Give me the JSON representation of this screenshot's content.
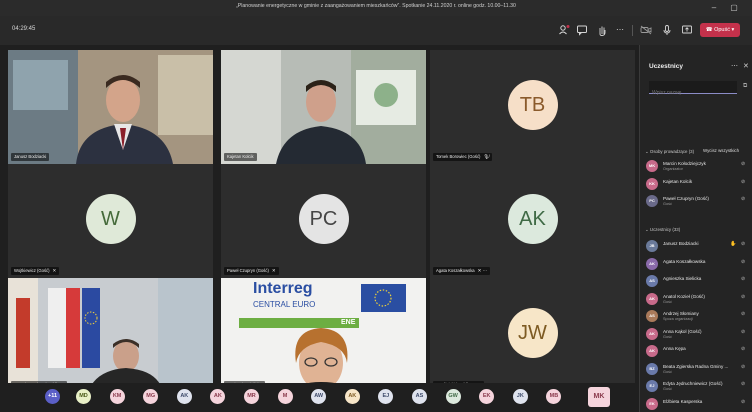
{
  "window": {
    "title": "„Planowanie energetyczne w gminie z zaangażowaniem mieszkańców”. Spotkanie 24.11.2020 r. online godz. 10.00–11.30"
  },
  "toolbar": {
    "timer": "04:29:45",
    "leave_label": "Opuść"
  },
  "tiles": [
    {
      "label": "Janusz Bodziacki",
      "type": "video",
      "bg": "#7a6a5a"
    },
    {
      "label": "Kajetan Kolcik",
      "type": "video",
      "bg": "#8a8f86"
    },
    {
      "label": "Tomek Borowiec (Gość)",
      "type": "avatar",
      "initials": "TB",
      "avatar_bg": "#f6dfc8",
      "avatar_fg": "#8a5a2b"
    },
    {
      "label": "Wojtkiewicz (Gość)",
      "type": "avatar",
      "initials": "W",
      "avatar_bg": "#dfe9d8",
      "avatar_fg": "#456a3a"
    },
    {
      "label": "Paweł Czupryn (Gość)",
      "type": "avatar",
      "initials": "PC",
      "avatar_bg": "#e4e4e4",
      "avatar_fg": "#454545"
    },
    {
      "label": "Agata Koszałkowska",
      "type": "avatar",
      "initials": "AK",
      "avatar_bg": "#dce9dd",
      "avatar_fg": "#3f6a45"
    },
    {
      "label": "Henryk Smolarz (Gość)",
      "type": "video",
      "bg": "#8d9aa6"
    },
    {
      "label": "Agnieszka Sielicka",
      "type": "video",
      "bg": "#e9ecec"
    },
    {
      "label": "J Wójcicki (Gość)",
      "type": "avatar",
      "initials": "JW",
      "avatar_bg": "#f7e6c8",
      "avatar_fg": "#7d5a22"
    }
  ],
  "slide": {
    "brand": "Interreg",
    "program": "CENTRAL EURO",
    "partial": "ENE"
  },
  "overflow": {
    "count": "+11",
    "avatars": [
      {
        "initials": "MD",
        "bg": "#e8f0c7",
        "fg": "#4a5a18"
      },
      {
        "initials": "KM",
        "bg": "#f5d4dc",
        "fg": "#8a3a4c"
      },
      {
        "initials": "MG",
        "bg": "#f5d4dc",
        "fg": "#8a3a4c"
      },
      {
        "initials": "AK",
        "bg": "#dfe3ee",
        "fg": "#3d4a6a"
      },
      {
        "initials": "AK",
        "bg": "#f5d4dc",
        "fg": "#8a3a4c"
      },
      {
        "initials": "MR",
        "bg": "#f5d4dc",
        "fg": "#8a3a4c"
      },
      {
        "initials": "M",
        "bg": "#f5d4dc",
        "fg": "#8a3a4c"
      },
      {
        "initials": "AW",
        "bg": "#dfe3ee",
        "fg": "#3d4a6a"
      },
      {
        "initials": "AK",
        "bg": "#f7e6c8",
        "fg": "#7d5a22"
      },
      {
        "initials": "EJ",
        "bg": "#dfe3ee",
        "fg": "#3d4a6a"
      },
      {
        "initials": "AS",
        "bg": "#dfe3ee",
        "fg": "#3d4a6a"
      },
      {
        "initials": "GW",
        "bg": "#dce9dd",
        "fg": "#3f6a45"
      },
      {
        "initials": "EK",
        "bg": "#f5d4dc",
        "fg": "#8a3a4c"
      },
      {
        "initials": "JK",
        "bg": "#dfe3ee",
        "fg": "#3d4a6a"
      },
      {
        "initials": "MB",
        "bg": "#f5d4dc",
        "fg": "#8a3a4c"
      }
    ],
    "last": {
      "initials": "MK",
      "bg": "#f5d4dc",
      "fg": "#8a3a4c"
    }
  },
  "panel": {
    "title": "Uczestnicy",
    "search_placeholder": "Wpisz nazwę",
    "presenters_head": "Osoby prowadzące (3)",
    "unmute_all": "Wycisz wszystkich",
    "attendees_head": "Uczestnicy (33)",
    "presenters": [
      {
        "initials": "MK",
        "name": "Marcin Kołodziejczyk",
        "role": "Organizator",
        "bg": "#c86a8a"
      },
      {
        "initials": "KK",
        "name": "Kajetan Kolcik",
        "role": "",
        "bg": "#c86a8a"
      },
      {
        "initials": "PC",
        "name": "Paweł Czupryn (Gość)",
        "role": "Gość",
        "bg": "#6a6a8a"
      }
    ],
    "attendees": [
      {
        "initials": "JB",
        "name": "Janusz Bodziacki",
        "role": "",
        "bg": "#6a7a9a",
        "hand": true
      },
      {
        "initials": "AK",
        "name": "Agata Koszałkowska",
        "role": "",
        "bg": "#8a6aaa"
      },
      {
        "initials": "AS",
        "name": "Agnieszka Sielicka",
        "role": "",
        "bg": "#6a7aaa"
      },
      {
        "initials": "AK",
        "name": "Anatol Kozieł (Gość)",
        "role": "Gość",
        "bg": "#c86a8a"
      },
      {
        "initials": "AS",
        "name": "Andrzej Słomiany",
        "role": "Spoza organizacji",
        "bg": "#aa7a5a"
      },
      {
        "initials": "AK",
        "name": "Anna Kąkol (Gość)",
        "role": "Gość",
        "bg": "#c86a8a"
      },
      {
        "initials": "AK",
        "name": "Anna Kępa",
        "role": "",
        "bg": "#c86a8a"
      },
      {
        "initials": "BZ",
        "name": "Beata Zgierska Radna Gminy ...",
        "role": "Gość",
        "bg": "#6a7aaa"
      },
      {
        "initials": "EJ",
        "name": "Edyta Jędruchniewicz (Gość)",
        "role": "Gość",
        "bg": "#6a7aaa"
      },
      {
        "initials": "EK",
        "name": "Elżbieta Kasperska",
        "role": "",
        "bg": "#c86a8a"
      },
      {
        "initials": "GW",
        "name": "Gmina Siedliska nad Wolą (Gość...",
        "role": "Gość",
        "bg": "#6a8a6a"
      }
    ]
  }
}
